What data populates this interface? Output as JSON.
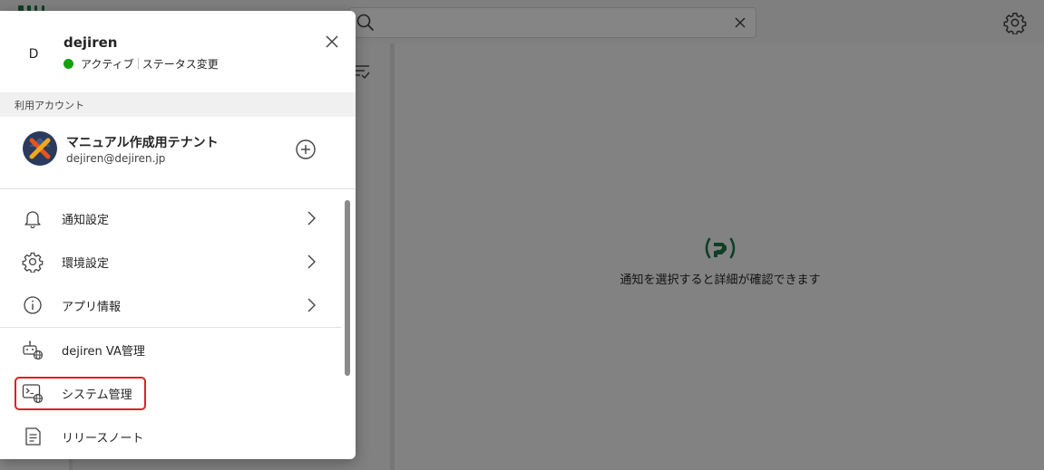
{
  "search": {
    "placeholder": ""
  },
  "empty_state": {
    "message": "通知を選択すると詳細が確認できます"
  },
  "account_panel": {
    "avatar_initial": "D",
    "user_name": "dejiren",
    "status": "アクティブ",
    "status_change": "ステータス変更",
    "status_color": "#13a10e",
    "section_label": "利用アカウント",
    "tenant": {
      "name": "マニュアル作成用テナント",
      "email": "dejiren@dejiren.jp"
    },
    "menu": [
      {
        "label": "通知設定",
        "icon": "bell-icon"
      },
      {
        "label": "環境設定",
        "icon": "gear-icon"
      },
      {
        "label": "アプリ情報",
        "icon": "info-icon"
      },
      {
        "label": "dejiren VA管理",
        "icon": "bot-globe-icon"
      },
      {
        "label": "システム管理",
        "icon": "terminal-globe-icon"
      },
      {
        "label": "リリースノート",
        "icon": "document-icon"
      }
    ]
  },
  "colors": {
    "brand_green": "#1d7a4c",
    "highlight_red": "#e02020"
  }
}
